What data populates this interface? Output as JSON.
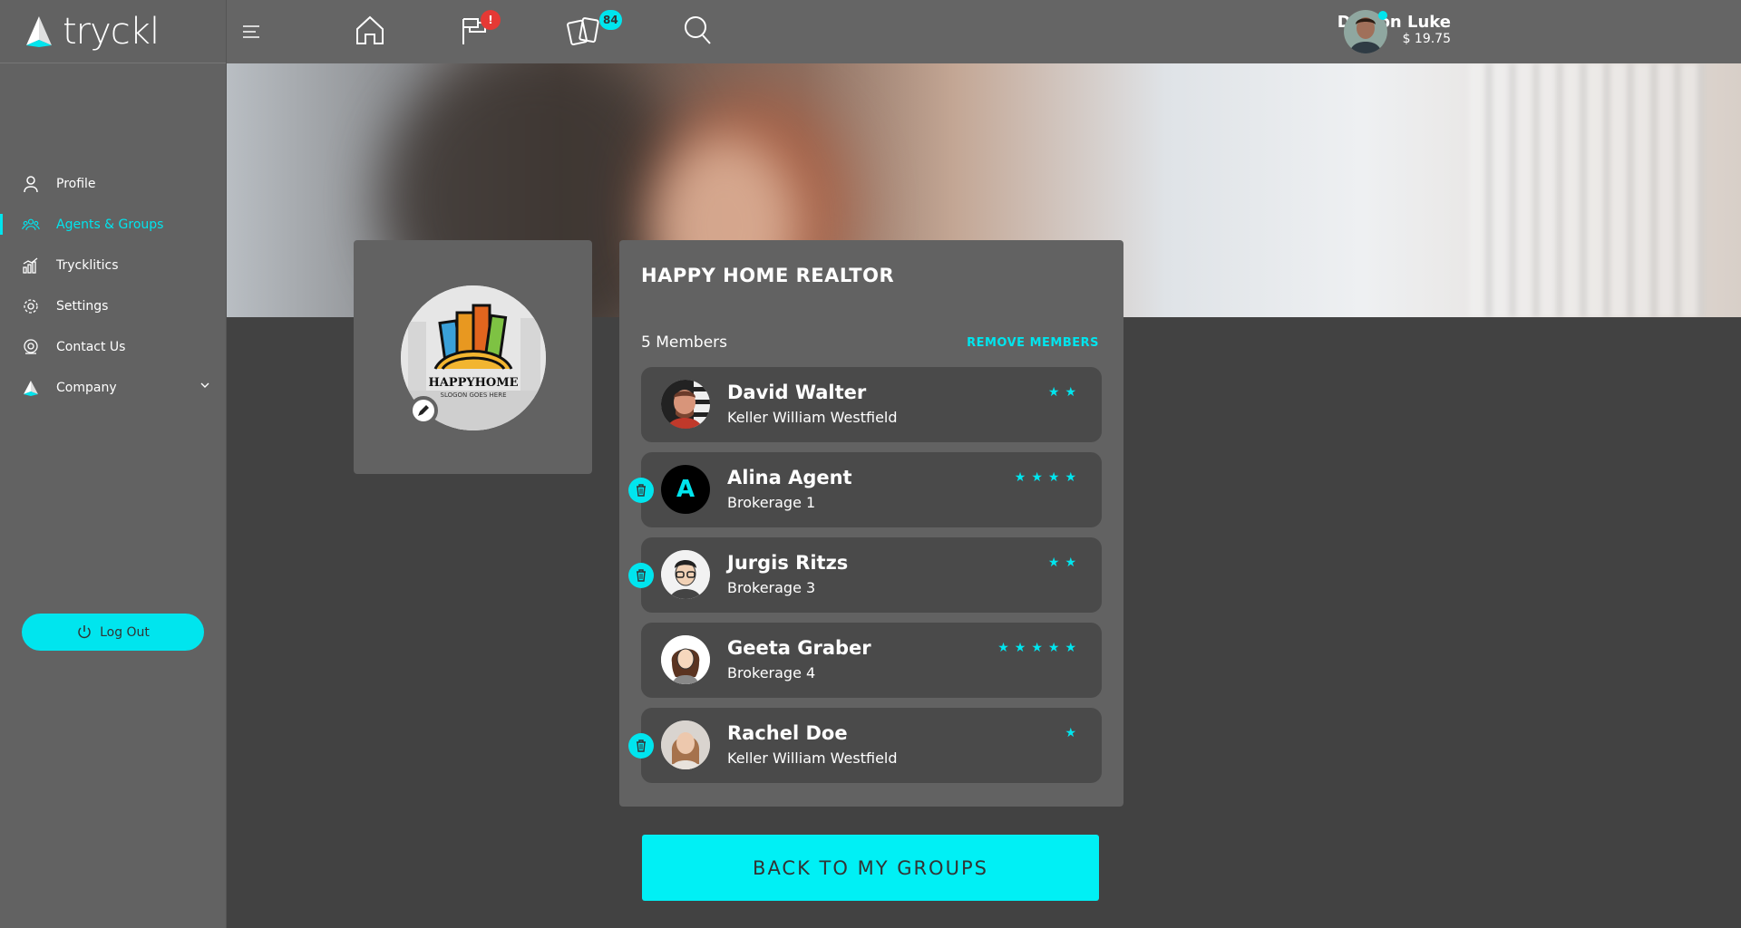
{
  "brand": {
    "name": "tryckl"
  },
  "sidebar": {
    "items": [
      {
        "label": "Profile",
        "icon": "user-icon"
      },
      {
        "label": "Agents & Groups",
        "icon": "group-icon",
        "active": true
      },
      {
        "label": "Trycklitics",
        "icon": "chart-icon"
      },
      {
        "label": "Settings",
        "icon": "gear-icon"
      },
      {
        "label": "Contact Us",
        "icon": "support-icon"
      },
      {
        "label": "Company",
        "icon": "company-logo-icon"
      }
    ],
    "logout_label": "Log Out"
  },
  "topbar": {
    "notifications_badge": "!",
    "cards_badge": "84",
    "user_name": "Damon Luke",
    "user_balance": "$ 19.75"
  },
  "group": {
    "title": "HAPPY HOME REALTOR",
    "logo_text": "HAPPYHOME",
    "logo_slogan": "SLOGON GOES HERE",
    "members_count": "5 Members",
    "remove_label": "REMOVE MEMBERS",
    "members": [
      {
        "name": "David Walter",
        "brokerage": "Keller William Westfield",
        "stars": "★★",
        "removable": false
      },
      {
        "name": "Alina Agent",
        "brokerage": "Brokerage 1",
        "stars": "★★★★",
        "removable": true,
        "initial": "A"
      },
      {
        "name": "Jurgis Ritzs",
        "brokerage": "Brokerage 3",
        "stars": "★★",
        "removable": true
      },
      {
        "name": "Geeta Graber",
        "brokerage": "Brokerage 4",
        "stars": "★★★★★",
        "removable": false
      },
      {
        "name": "Rachel Doe",
        "brokerage": "Keller William Westfield",
        "stars": "★",
        "removable": true
      }
    ],
    "back_label": "BACK TO MY GROUPS"
  },
  "colors": {
    "accent": "#00e5ee",
    "sidebar": "#626262",
    "background": "#424242",
    "alert": "#e53935"
  }
}
